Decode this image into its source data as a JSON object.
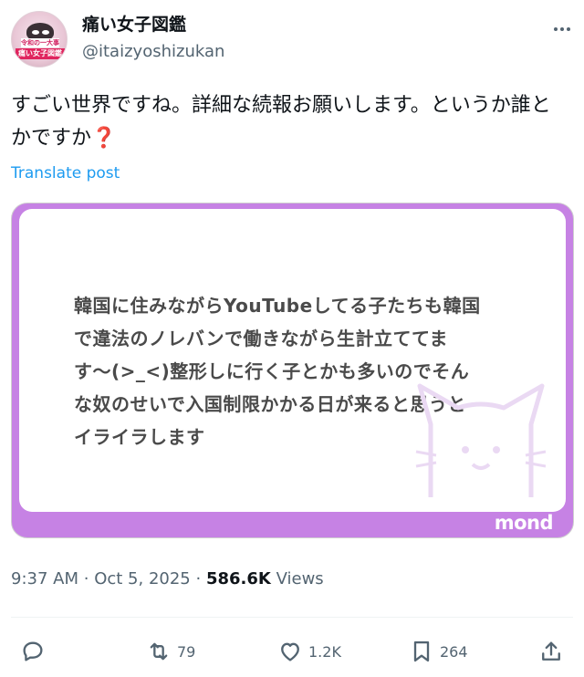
{
  "author": {
    "display_name": "痛い女子図鑑",
    "handle": "@itaizyoshizukan",
    "avatar_text_top": "令和の一大事",
    "avatar_text_bottom": "痛い女子図鑑"
  },
  "post": {
    "text": "すごい世界ですね。詳細な続報お願いします。というか誰とかですか",
    "emoji": "❓",
    "translate_label": "Translate post"
  },
  "card": {
    "lines": [
      "韓国に住みながらYouTubeしてる子たちも韓国",
      "で違法のノレバンで働きながら生計立ててま",
      "す〜(>_<)整形しに行く子とかも多いのでそん",
      "な奴のせいで入国制限かかる日が来ると思うと",
      "イライラします"
    ],
    "brand": "mond",
    "colors": {
      "frame": "#c682e4",
      "text": "#4a4a4a"
    }
  },
  "meta": {
    "time": "9:37 AM",
    "separator": "·",
    "date": "Oct 5, 2025",
    "views_count": "586.6K",
    "views_label": "Views"
  },
  "actions": {
    "reply": {
      "icon": "reply-icon",
      "count": ""
    },
    "repost": {
      "icon": "repost-icon",
      "count": "79"
    },
    "like": {
      "icon": "heart-icon",
      "count": "1.2K"
    },
    "bookmark": {
      "icon": "bookmark-icon",
      "count": "264"
    },
    "share": {
      "icon": "share-icon",
      "count": ""
    }
  },
  "colors": {
    "accent": "#1d9bf0",
    "muted": "#536471",
    "text": "#0f1419"
  }
}
